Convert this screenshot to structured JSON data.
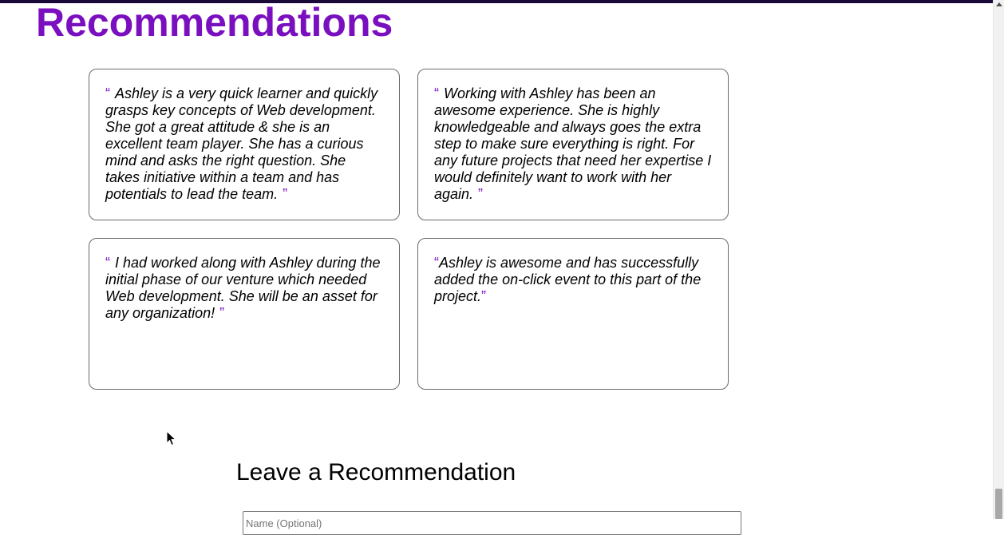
{
  "section": {
    "title": "Recommendations"
  },
  "quote_marks": {
    "open": "“",
    "close": "”"
  },
  "recommendations": [
    {
      "text": "Ashley is a very quick learner and quickly grasps key concepts of Web development. She got a great attitude & she is an excellent team player. She has a curious mind and asks the right question. She takes initiative within a team and has potentials to lead the team."
    },
    {
      "text": "Working with Ashley has been an awesome experience. She is highly knowledgeable and always goes the extra step to make sure everything is right. For any future projects that need her expertise I would definitely want to work with her again."
    },
    {
      "text": "I had worked along with Ashley during the initial phase of our venture which needed Web development. She will be an asset for any organization!"
    },
    {
      "text": "Ashley is awesome and has successfully added the on-click event to this part of the project."
    }
  ],
  "form": {
    "title": "Leave a Recommendation",
    "name_placeholder": "Name (Optional)",
    "name_value": ""
  },
  "colors": {
    "accent": "#7a0fbf",
    "card_border": "#6b6b6b",
    "top_bar": "#1a0a3a"
  },
  "icons": {
    "cursor": "arrow-cursor-icon",
    "scroll_up": "scroll-up-arrow-icon"
  }
}
